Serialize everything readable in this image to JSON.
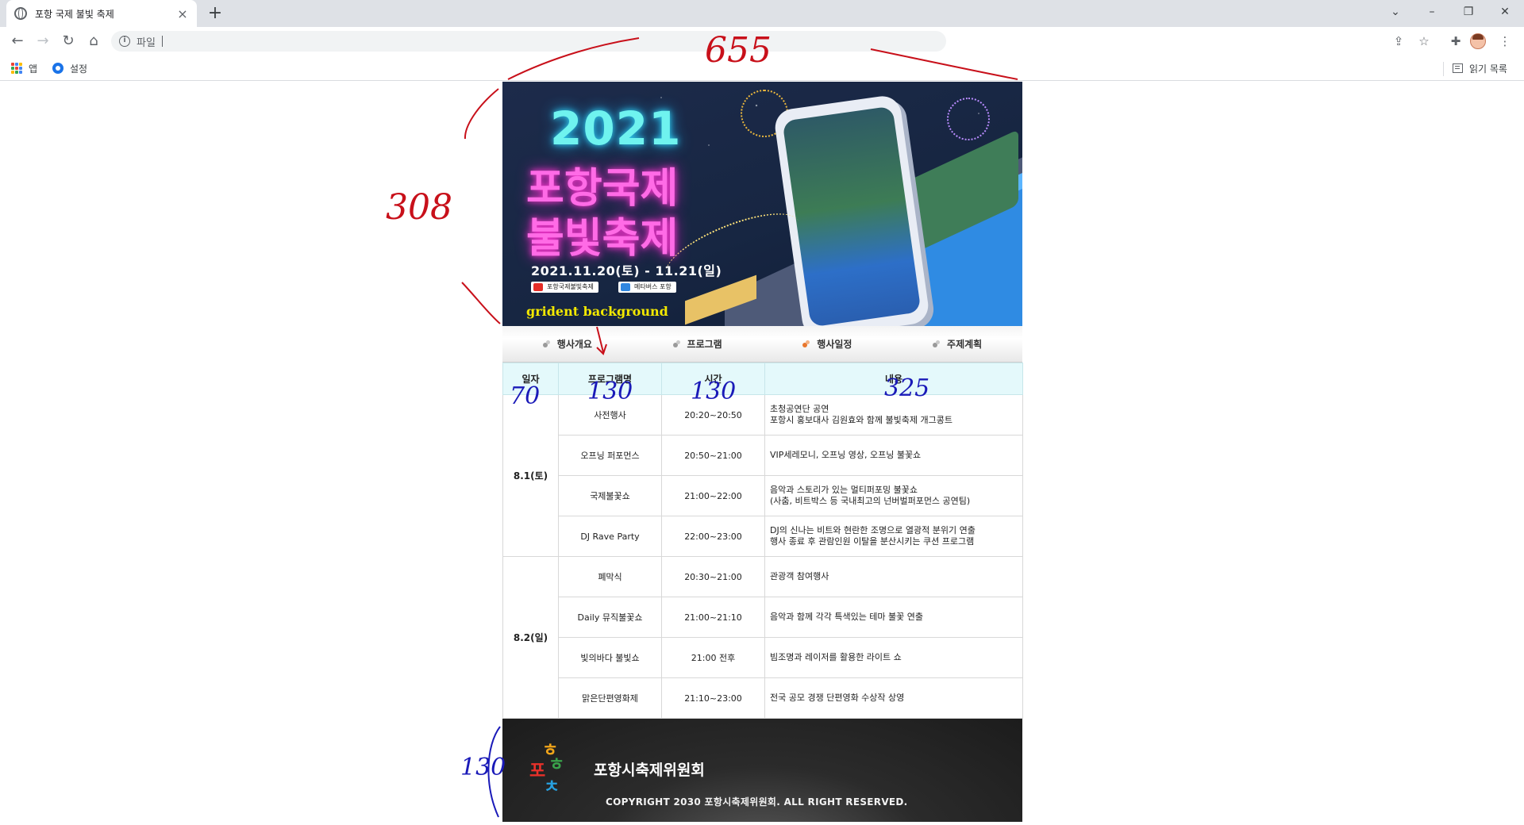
{
  "browser": {
    "tab_title": "포항 국제 불빛 축제",
    "omnibox_label": "파일",
    "omnibox_value": "",
    "bookmarks": [
      {
        "label": "앱",
        "icon": "apps-grid-icon"
      },
      {
        "label": "설정",
        "icon": "gear-icon"
      }
    ],
    "reading_list": "읽기 목록"
  },
  "banner": {
    "year": "2021",
    "title_line1": "포항국제",
    "title_line2": "불빛축제",
    "date": "2021.11.20(토) - 11.21(일)",
    "badge1": "포항국제불빛축제",
    "badge2": "메타버스 포항",
    "note": "grident background"
  },
  "menu": [
    "행사개요",
    "프로그램",
    "행사일정",
    "주제계획"
  ],
  "table": {
    "headers": [
      "일자",
      "프로그램명",
      "시간",
      "내용"
    ],
    "day1": {
      "date": "8.1(토)",
      "rows": [
        {
          "program": "사전행사",
          "time": "20:20~20:50",
          "line1": "초청공연단 공연",
          "line2": "포항시 홍보대사 김원효와 함께 불빛축제 개그콩트"
        },
        {
          "program": "오프닝 퍼포먼스",
          "time": "20:50~21:00",
          "line1": "VIP세레모니, 오프닝 영상, 오프닝 불꽃쇼",
          "line2": ""
        },
        {
          "program": "국제불꽃쇼",
          "time": "21:00~22:00",
          "line1": "음악과 스토리가 있는 멀티퍼포밍 불꽃쇼",
          "line2": "(사춤, 비트박스 등 국내최고의 넌버벌퍼포먼스 공연팀)"
        },
        {
          "program": "DJ Rave Party",
          "time": "22:00~23:00",
          "line1": "DJ의 신나는 비트와 현란한 조명으로 열광적 분위기 연출",
          "line2": "행사 종료 후 관람인원 이탈을 분산시키는 쿠션 프로그램"
        }
      ]
    },
    "day2": {
      "date": "8.2(일)",
      "rows": [
        {
          "program": "폐막식",
          "time": "20:30~21:00",
          "line1": "관광객 참여행사",
          "line2": ""
        },
        {
          "program": "Daily 뮤직불꽃쇼",
          "time": "21:00~21:10",
          "line1": "음악과 함께 각각 특색있는 테마 불꽃 연출",
          "line2": ""
        },
        {
          "program": "빛의바다 불빛쇼",
          "time": "21:00 전후",
          "line1": "빔조명과 레이저를 활용한 라이트 쇼",
          "line2": ""
        },
        {
          "program": "맑은단편영화제",
          "time": "21:10~23:00",
          "line1": "전국 공모 경쟁 단편영화 수상작 상영",
          "line2": ""
        }
      ]
    }
  },
  "footer": {
    "org": "포항시축제위원회",
    "copyright": "COPYRIGHT 2030 포항시축제위원회. ALL RIGHT RESERVED."
  },
  "annotations": {
    "width": "655",
    "banner_height": "308",
    "col1": "70",
    "col2": "130",
    "col3": "130",
    "col4": "325",
    "footer_height": "130"
  }
}
